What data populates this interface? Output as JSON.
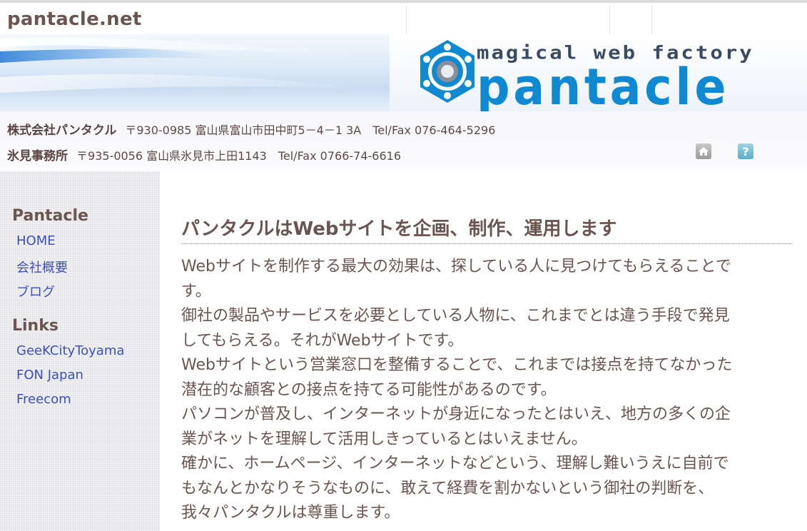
{
  "site": {
    "title": "pantacle.net"
  },
  "banner": {
    "tagline": "magical web factory",
    "brand": "pantacle"
  },
  "company": {
    "main_name": "株式会社パンタクル",
    "main_address": "〒930-0985 富山県富山市田中町5－4－1 3A　Tel/Fax 076-464-5296",
    "branch_name": "氷見事務所",
    "branch_address": "〒935-0056 富山県氷見市上田1143　Tel/Fax 0766-74-6616"
  },
  "icons": {
    "home": "home-icon",
    "help": "help-icon",
    "help_glyph": "?"
  },
  "sidebar": {
    "sections": [
      {
        "heading": "Pantacle",
        "items": [
          "HOME",
          "会社概要",
          "ブログ"
        ]
      },
      {
        "heading": "Links",
        "items": [
          "GeeKCityToyama",
          "FON Japan",
          "Freecom"
        ]
      }
    ]
  },
  "main": {
    "heading": "パンタクルはWebサイトを企画、制作、運用します",
    "lines": [
      "Webサイトを制作する最大の効果は、探している人に見つけてもらえることで",
      "す。",
      "御社の製品やサービスを必要としている人物に、これまでとは違う手段で発見",
      "してもらえる。それがWebサイトです。",
      "Webサイトという営業窓口を整備することで、これまでは接点を持てなかった",
      "潜在的な顧客との接点を持てる可能性があるのです。",
      "パソコンが普及し、インターネットが身近になったとはいえ、地方の多くの企",
      "業がネットを理解して活用しきっているとはいえません。",
      "確かに、ホームページ、インターネットなどという、理解し難いうえに自前で",
      "もなんとかなりそうなものに、敢えて経費を割かないという御社の判断を、",
      "我々パンタクルは尊重します。"
    ]
  },
  "colors": {
    "text": "#6b5550",
    "link": "#3d4fc0",
    "brand": "#0f8ad2",
    "sidebar_bg": "#f1f1f3"
  }
}
